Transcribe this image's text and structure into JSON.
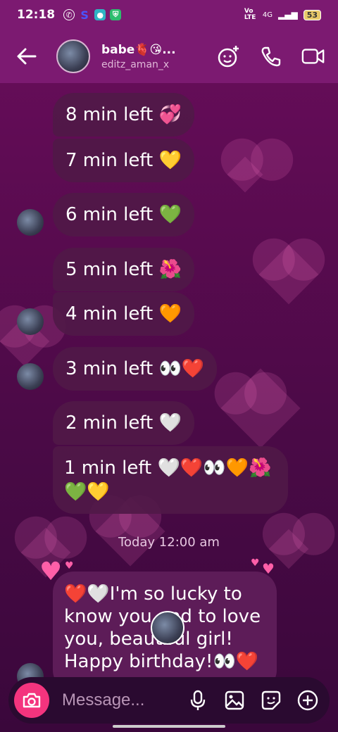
{
  "status": {
    "time": "12:18",
    "network": "4G",
    "volte": "Vo LTE",
    "battery": "53"
  },
  "header": {
    "title": "babe🫀😘...",
    "subtitle": "editz_aman_x"
  },
  "messages": [
    {
      "text": "8 min left 💞"
    },
    {
      "text": "7 min left 💛"
    },
    {
      "text": "6 min left 💚"
    },
    {
      "text": "5 min left 🌺"
    },
    {
      "text": "4 min left 🧡"
    },
    {
      "text": "3 min left 👀❤️"
    },
    {
      "text": "2 min left 🤍"
    },
    {
      "text": "1 min left 🤍❤️👀🧡🌺"
    },
    {
      "text": "💚💛"
    }
  ],
  "timestamp": "Today 12:00 am",
  "last_message": "❤️🤍I'm so lucky to know you and to love you, beautiful girl! Happy birthday!👀❤️",
  "composer": {
    "placeholder": "Message..."
  },
  "colors": {
    "accent": "#f4347e",
    "header": "#7c1a71",
    "bubble": "#501948"
  }
}
